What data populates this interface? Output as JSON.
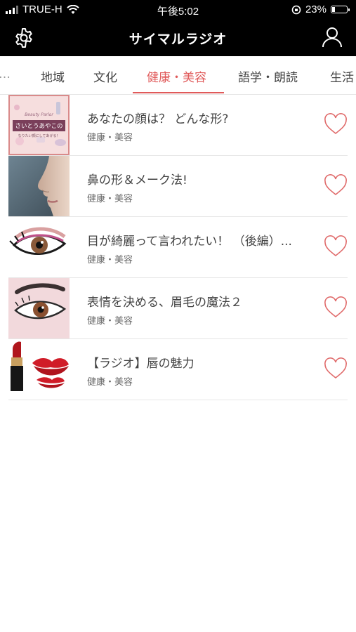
{
  "status_bar": {
    "carrier": "TRUE-H",
    "time": "午後5:02",
    "battery_percent": "23%",
    "battery_level": 0.23
  },
  "header": {
    "title": "サイマルラジオ",
    "settings_icon": "gear-icon",
    "account_icon": "user-icon"
  },
  "tabs": [
    {
      "label": "地域"
    },
    {
      "label": "文化"
    },
    {
      "label": "健康・美容",
      "active": true
    },
    {
      "label": "語学・朗読"
    },
    {
      "label": "生活"
    }
  ],
  "items": [
    {
      "title": "あなたの顔は？ どんな形?",
      "category": "健康・美容",
      "thumb": "beauty-parlor-banner",
      "thumb_text_1": "Beauty Parlor",
      "thumb_text_2": "さいとうあやこの",
      "thumb_text_3": "なりたい顔にしてあげる！"
    },
    {
      "title": "鼻の形＆メーク法!",
      "category": "健康・美容",
      "thumb": "nose-photo"
    },
    {
      "title": "目が綺麗って言われたい！ （後編）...",
      "category": "健康・美容",
      "thumb": "eye-makeup-illustration"
    },
    {
      "title": "表情を決める、眉毛の魔法２",
      "category": "健康・美容",
      "thumb": "eyebrow-illustration"
    },
    {
      "title": "【ラジオ】唇の魅力",
      "category": "健康・美容",
      "thumb": "lipstick-kiss-illustration"
    }
  ],
  "colors": {
    "accent": "#e05a5a",
    "header_bg": "#000000",
    "heart": "#e06a6a"
  }
}
